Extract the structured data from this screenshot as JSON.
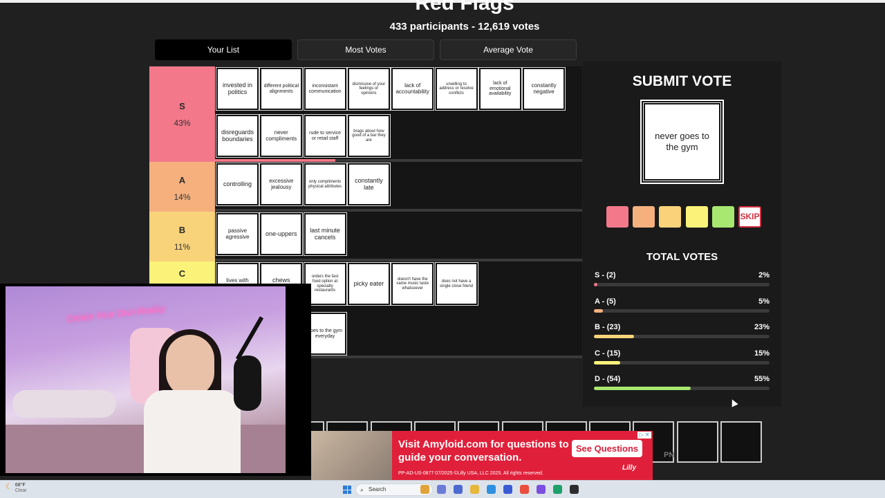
{
  "site": {
    "title": "Red Flags",
    "participants": "433 participants - 12,619 votes"
  },
  "tabs": [
    {
      "label": "Your List"
    },
    {
      "label": "Most Votes"
    },
    {
      "label": "Average Vote"
    }
  ],
  "tiers": [
    {
      "name": "S",
      "pct": "43%",
      "color": "#f2788a",
      "cards": [
        "invested in politics",
        "different political alignments",
        "inconsistant communication",
        "dismissive of your feelings or opinions",
        "lack of accountability",
        "unwilling to address or resolve conflicts",
        "lack of emotional availability",
        "constantly negative",
        "disreguards boundaries",
        "never compliments",
        "rude to service or retail staff",
        "brags about how good of a bar they are"
      ]
    },
    {
      "name": "A",
      "pct": "14%",
      "color": "#f5b07e",
      "cards": [
        "controlling",
        "excessive jealousy",
        "only compliments physical attributes",
        "constantly late"
      ]
    },
    {
      "name": "B",
      "pct": "11%",
      "color": "#f8d37a",
      "cards": [
        "passive agressive",
        "one-uppers",
        "last minute cancels"
      ]
    },
    {
      "name": "C",
      "pct": "",
      "color": "#fbf27a",
      "cards": [
        "lives with parents",
        "chews loudly",
        "orders the fast food option at specialty restaurants",
        "picky eater",
        "doesn't have the same music taste whatsoever",
        "does not have a single close friend",
        "goes to the gym everyday"
      ]
    }
  ],
  "vote_panel": {
    "title": "SUBMIT VOTE",
    "current_card": "never goes to the gym",
    "buttons": [
      {
        "color": "#f2788a"
      },
      {
        "color": "#f5b07e"
      },
      {
        "color": "#f8d37a"
      },
      {
        "color": "#fbf27a"
      },
      {
        "color": "#a8e870"
      }
    ],
    "skip_label": "SKIP",
    "total_title": "TOTAL VOTES",
    "totals": [
      {
        "label": "S - (2)",
        "pct": "2%",
        "value": 2,
        "color": "#f2788a"
      },
      {
        "label": "A - (5)",
        "pct": "5%",
        "value": 5,
        "color": "#f5b07e"
      },
      {
        "label": "B - (23)",
        "pct": "23%",
        "value": 23,
        "color": "#f8d37a"
      },
      {
        "label": "C - (15)",
        "pct": "15%",
        "value": 15,
        "color": "#fbf27a"
      },
      {
        "label": "D - (54)",
        "pct": "55%",
        "value": 55,
        "color": "#a8e870"
      }
    ]
  },
  "stream_overlay": {
    "neon_sign": "Create Your Own Reality"
  },
  "ad": {
    "headline": "Visit Amyloid.com for questions to guide your conversation.",
    "button": "See Questions",
    "fine_print": "PP-AD-US-0877 07/2025 ©Lilly USA, LLC 2025. All rights reserved.",
    "logo": "Lilly",
    "close": "▷ ✕"
  },
  "bottom_fragment": "PN",
  "taskbar": {
    "temp": "68°F",
    "condition": "Clear",
    "search": "Search",
    "icon_colors": [
      "#e0a33a",
      "#6a7bd8",
      "#4c6ad0",
      "#e6b73c",
      "#2f8fe0",
      "#3b5bd6",
      "#eb4d3d",
      "#7b4fe0",
      "#1ea06a",
      "#2d2d2d"
    ]
  }
}
